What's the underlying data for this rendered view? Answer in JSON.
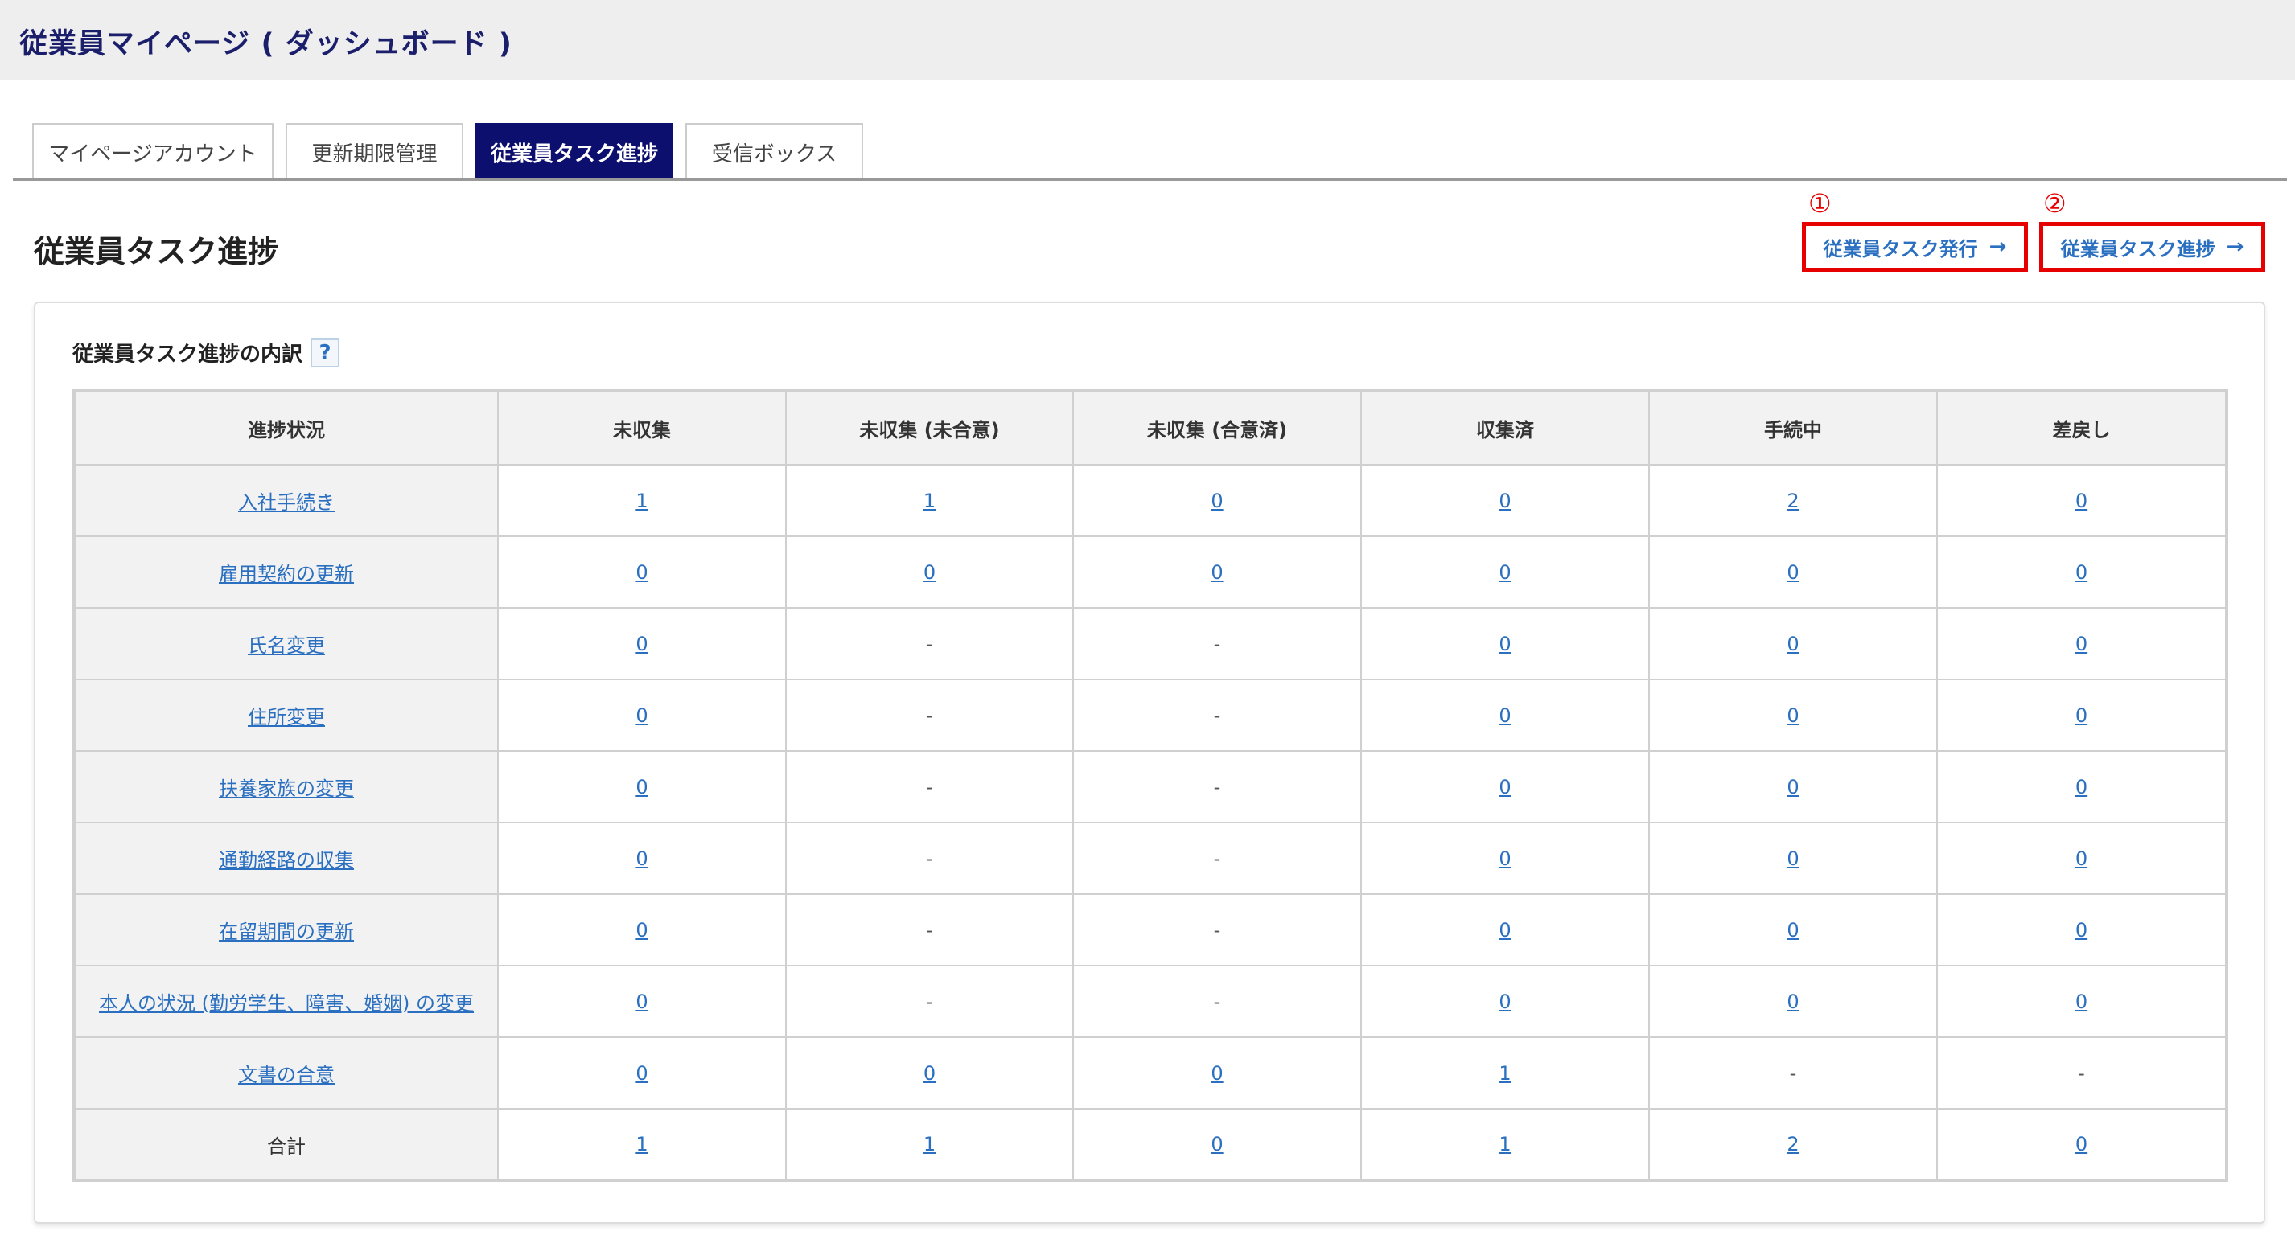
{
  "header": {
    "title": "従業員マイページ ( ダッシュボード )"
  },
  "tabs": [
    {
      "label": "マイページアカウント",
      "active": false
    },
    {
      "label": "更新期限管理",
      "active": false
    },
    {
      "label": "従業員タスク進捗",
      "active": true
    },
    {
      "label": "受信ボックス",
      "active": false
    }
  ],
  "section": {
    "title": "従業員タスク進捗"
  },
  "annotations": {
    "one": "①",
    "two": "②"
  },
  "actions": {
    "issue": {
      "label": "従業員タスク発行",
      "arrow": "→"
    },
    "progress": {
      "label": "従業員タスク進捗",
      "arrow": "→"
    }
  },
  "card": {
    "title": "従業員タスク進捗の内訳",
    "help": "?"
  },
  "table": {
    "headers": [
      "進捗状況",
      "未収集",
      "未収集 (未合意)",
      "未収集 (合意済)",
      "収集済",
      "手続中",
      "差戻し"
    ],
    "rows": [
      {
        "label": "入社手続き",
        "cells": [
          "1",
          "1",
          "0",
          "0",
          "2",
          "0"
        ]
      },
      {
        "label": "雇用契約の更新",
        "cells": [
          "0",
          "0",
          "0",
          "0",
          "0",
          "0"
        ]
      },
      {
        "label": "氏名変更",
        "cells": [
          "0",
          "-",
          "-",
          "0",
          "0",
          "0"
        ]
      },
      {
        "label": "住所変更",
        "cells": [
          "0",
          "-",
          "-",
          "0",
          "0",
          "0"
        ]
      },
      {
        "label": "扶養家族の変更",
        "cells": [
          "0",
          "-",
          "-",
          "0",
          "0",
          "0"
        ]
      },
      {
        "label": "通勤経路の収集",
        "cells": [
          "0",
          "-",
          "-",
          "0",
          "0",
          "0"
        ]
      },
      {
        "label": "在留期間の更新",
        "cells": [
          "0",
          "-",
          "-",
          "0",
          "0",
          "0"
        ]
      },
      {
        "label": "本人の状況 (勤労学生、障害、婚姻) の変更",
        "cells": [
          "0",
          "-",
          "-",
          "0",
          "0",
          "0"
        ]
      },
      {
        "label": "文書の合意",
        "cells": [
          "0",
          "0",
          "0",
          "1",
          "-",
          "-"
        ]
      }
    ],
    "total": {
      "label": "合計",
      "cells": [
        "1",
        "1",
        "0",
        "1",
        "2",
        "0"
      ]
    }
  }
}
